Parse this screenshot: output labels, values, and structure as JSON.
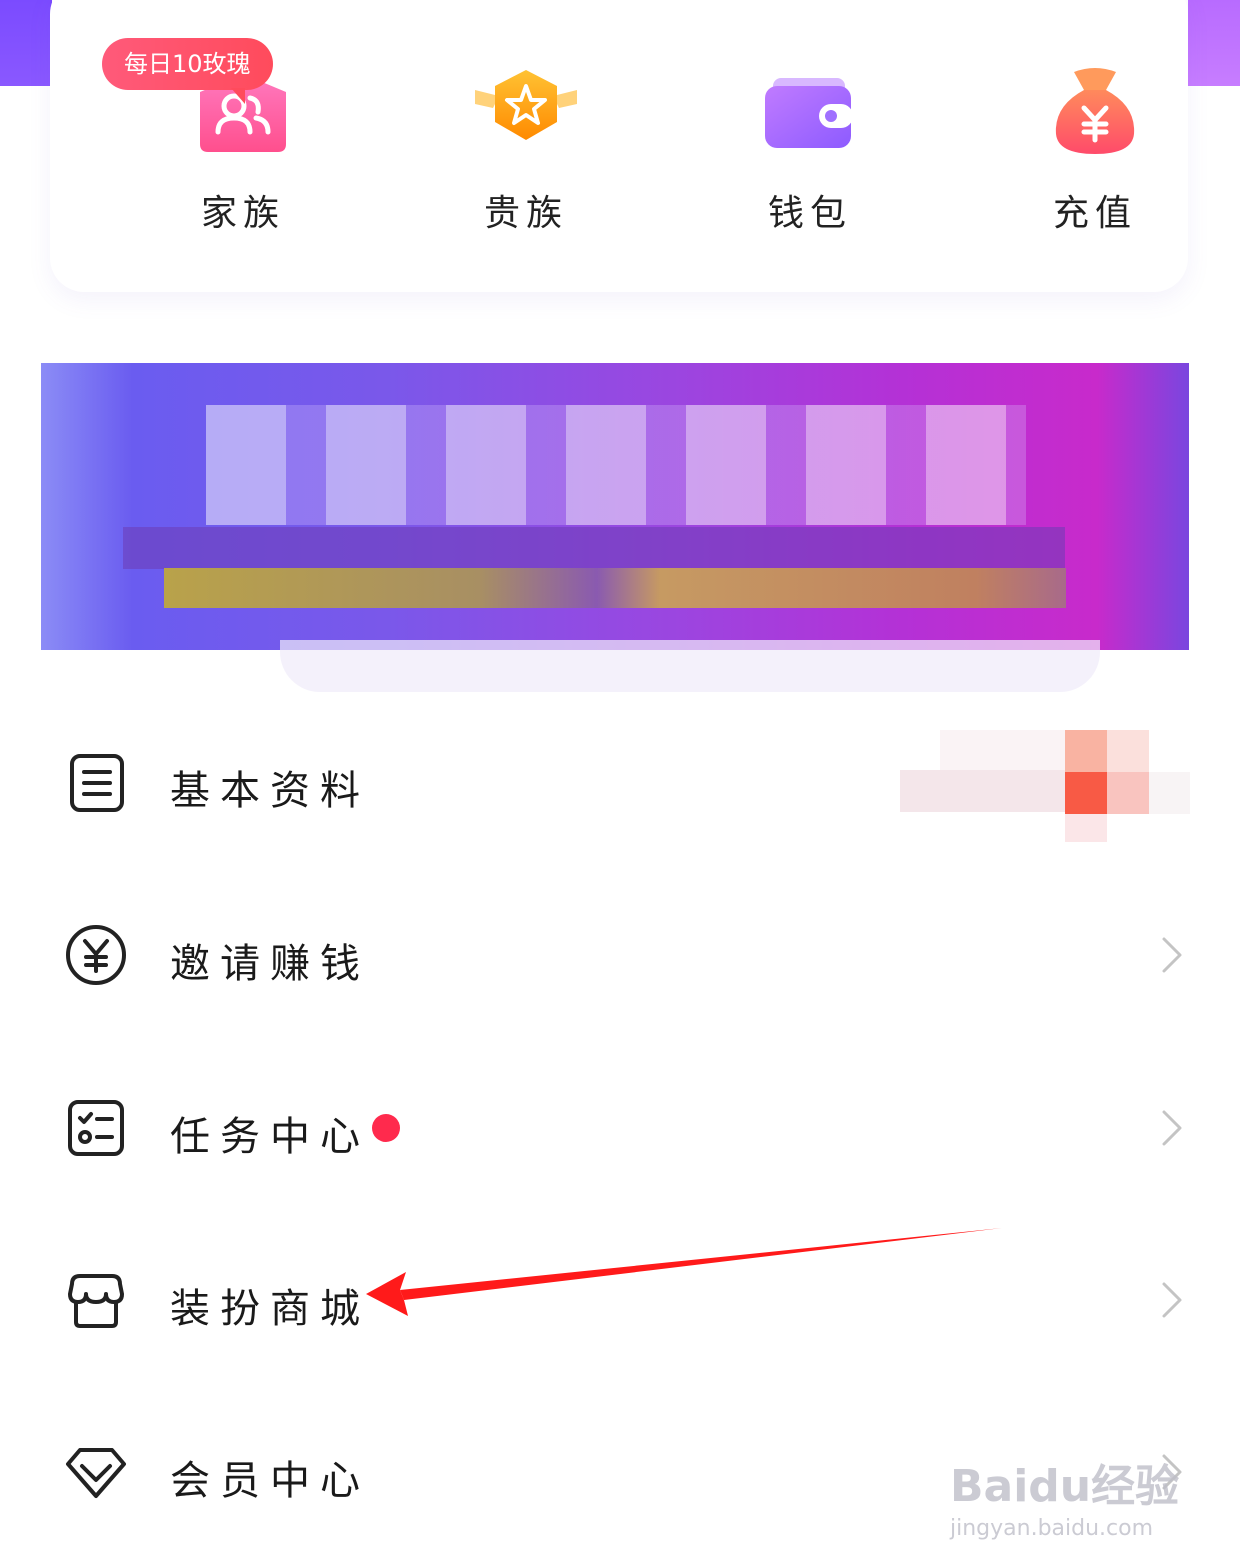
{
  "quick_actions": {
    "badge": "每日10玫瑰",
    "items": [
      {
        "label": "家族",
        "icon": "family-icon",
        "color": "#ff5aa0"
      },
      {
        "label": "贵族",
        "icon": "noble-badge-icon",
        "color": "#ffa018"
      },
      {
        "label": "钱包",
        "icon": "wallet-icon",
        "color": "#9b6bff"
      },
      {
        "label": "充值",
        "icon": "money-bag-icon",
        "color": "#ff5a4a"
      }
    ]
  },
  "menu": {
    "items": [
      {
        "label": "基本资料",
        "icon": "profile-doc-icon"
      },
      {
        "label": "邀请赚钱",
        "icon": "yuan-circle-icon"
      },
      {
        "label": "任务中心",
        "icon": "task-list-icon",
        "has_dot": true
      },
      {
        "label": "装扮商城",
        "icon": "store-icon"
      },
      {
        "label": "会员中心",
        "icon": "diamond-icon"
      }
    ]
  },
  "watermark": {
    "brand": "Baidu经验",
    "url": "jingyan.baidu.com"
  },
  "colors": {
    "accent_purple": "#8a58ff",
    "notify_red": "#ff2a4d",
    "arrow_red": "#ff1a1a"
  }
}
